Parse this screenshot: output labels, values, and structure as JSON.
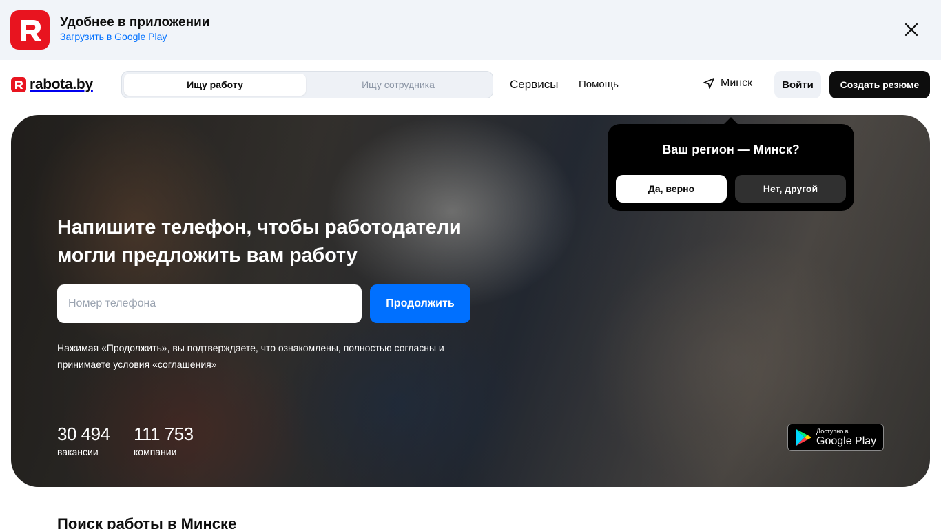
{
  "app_banner": {
    "title": "Удобнее в приложении",
    "link": "Загрузить в Google Play"
  },
  "header": {
    "logo_text": "rabota.by",
    "switcher": {
      "active": "Ищу работу",
      "inactive": "Ищу сотрудника"
    },
    "nav": {
      "services": "Сервисы",
      "help": "Помощь"
    },
    "region": "Минск",
    "login": "Войти",
    "create_resume": "Создать резюме"
  },
  "hero": {
    "title": "Напишите телефон, чтобы работодатели могли предложить вам работу",
    "phone_placeholder": "Номер телефона",
    "continue": "Продолжить",
    "terms_prefix": "Нажимая «Продолжить», вы подтверждаете, что ознакомлены, полностью согласны и принимаете условия «",
    "terms_link": "соглашения",
    "terms_suffix": "»",
    "stats": [
      {
        "value": "30 494",
        "label": "вакансии"
      },
      {
        "value": "111 753",
        "label": "компании"
      }
    ],
    "google_play": {
      "small": "Доступно в",
      "big": "Google Play"
    }
  },
  "region_popup": {
    "title": "Ваш регион — Минск?",
    "yes": "Да, верно",
    "no": "Нет, другой"
  },
  "section": {
    "title": "Поиск работы в Минске"
  },
  "colors": {
    "brand_red": "#e8141f",
    "accent_blue": "#0070ff",
    "dark": "#0d0d0d"
  }
}
